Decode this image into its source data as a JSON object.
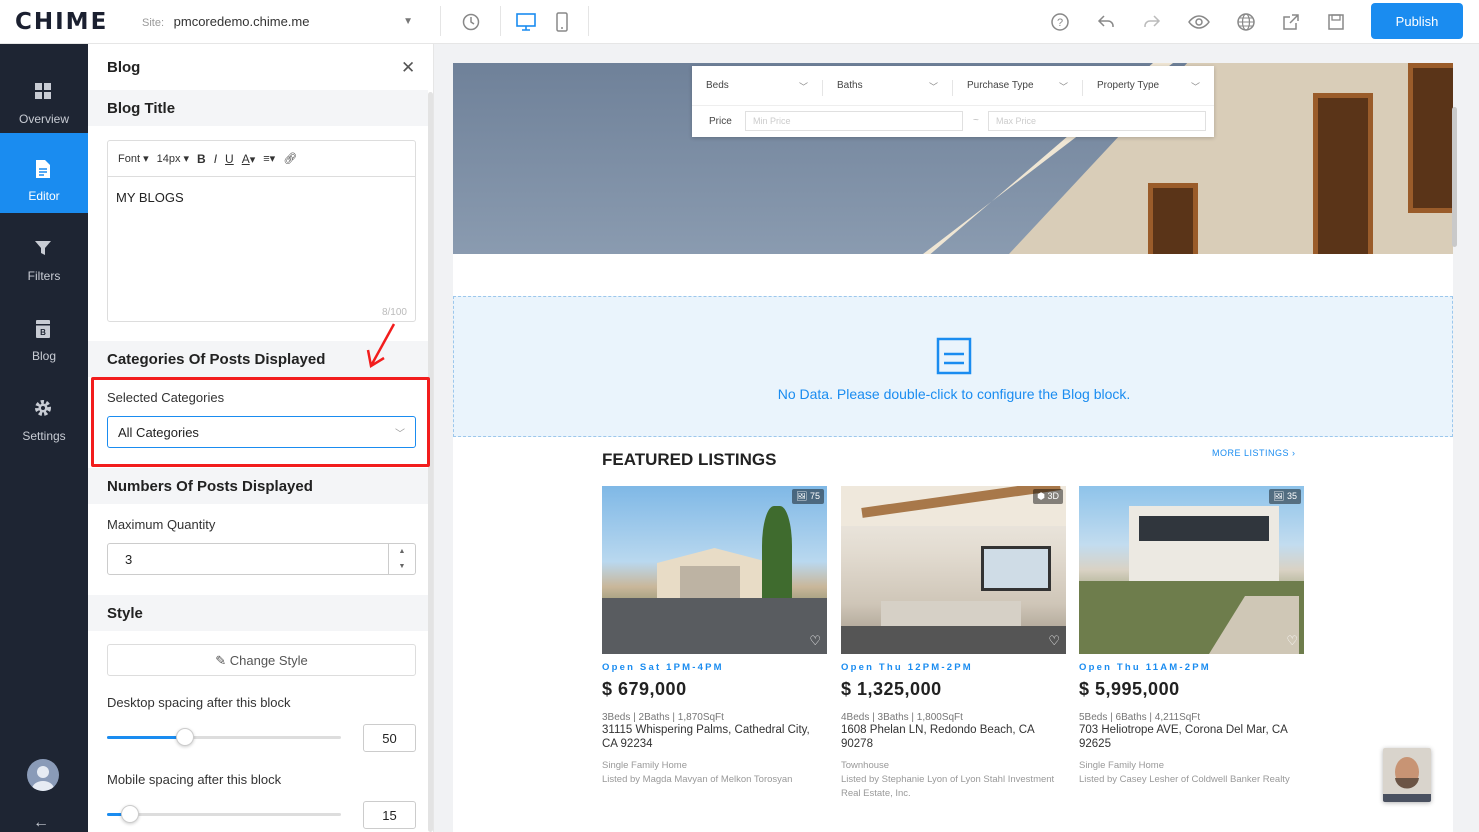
{
  "app": {
    "logo": "CHIME",
    "site_label": "Site:",
    "site_value": "pmcoredemo.chime.me",
    "publish_label": "Publish"
  },
  "toolbar_icons": [
    "history-icon",
    "desktop-icon",
    "mobile-icon",
    "help-icon",
    "undo-icon",
    "redo-icon",
    "preview-eye-icon",
    "globe-icon",
    "share-export-icon",
    "save-icon"
  ],
  "nav": {
    "items": [
      {
        "label": "Overview",
        "icon": "overview-grid-icon"
      },
      {
        "label": "Editor",
        "icon": "editor-document-icon",
        "active": true
      },
      {
        "label": "Filters",
        "icon": "filter-funnel-icon"
      },
      {
        "label": "Blog",
        "icon": "blog-icon"
      },
      {
        "label": "Settings",
        "icon": "gear-icon"
      }
    ]
  },
  "panel": {
    "title": "Blog",
    "blog_title_header": "Blog Title",
    "editor": {
      "font": "Font",
      "size": "14px",
      "bold": "B",
      "italic": "I",
      "underline": "U",
      "color": "A",
      "content": "MY BLOGS",
      "count": "8/100"
    },
    "categories_header": "Categories Of Posts Displayed",
    "selected_categories_label": "Selected Categories",
    "selected_categories_value": "All Categories",
    "numbers_header": "Numbers Of Posts Displayed",
    "max_quantity_label": "Maximum Quantity",
    "max_quantity_value": "3",
    "style_header": "Style",
    "change_style_label": "Change Style",
    "desktop_spacing_label": "Desktop spacing after this block",
    "desktop_spacing_value": "50",
    "mobile_spacing_label": "Mobile spacing after this block",
    "mobile_spacing_value": "15"
  },
  "search": {
    "beds": "Beds",
    "baths": "Baths",
    "purchase_type": "Purchase Type",
    "property_type": "Property Type",
    "price_label": "Price",
    "min_placeholder": "Min Price",
    "dash": "~",
    "max_placeholder": "Max Price"
  },
  "blog_block": {
    "message": "No Data. Please double-click to configure the Blog block."
  },
  "featured": {
    "title": "FEATURED LISTINGS",
    "more": "MORE LISTINGS ›"
  },
  "listings": [
    {
      "badge": "75",
      "open": "Open Sat 1PM-4PM",
      "price": "$ 679,000",
      "specs": "3Beds  |  2Baths  |  1,870SqFt",
      "address": "31115 Whispering Palms, Cathedral City, CA 92234",
      "type": "Single Family Home",
      "listed": "Listed by Magda Mavyan of Melkon Torosyan"
    },
    {
      "badge": "3D",
      "open": "Open Thu 12PM-2PM",
      "price": "$ 1,325,000",
      "specs": "4Beds  |  3Baths  |  1,800SqFt",
      "address": "1608 Phelan LN, Redondo Beach, CA 90278",
      "type": "Townhouse",
      "listed": "Listed by Stephanie Lyon of Lyon Stahl Investment Real Estate, Inc."
    },
    {
      "badge": "35",
      "open": "Open Thu 11AM-2PM",
      "price": "$ 5,995,000",
      "specs": "5Beds  |  6Baths  |  4,211SqFt",
      "address": "703 Heliotrope AVE, Corona Del Mar, CA 92625",
      "type": "Single Family Home",
      "listed": "Listed by Casey Lesher of Coldwell Banker Realty"
    }
  ],
  "colors": {
    "accent": "#1a8cf0",
    "nav_bg": "#1e2533",
    "highlight": "#f21d1d"
  }
}
